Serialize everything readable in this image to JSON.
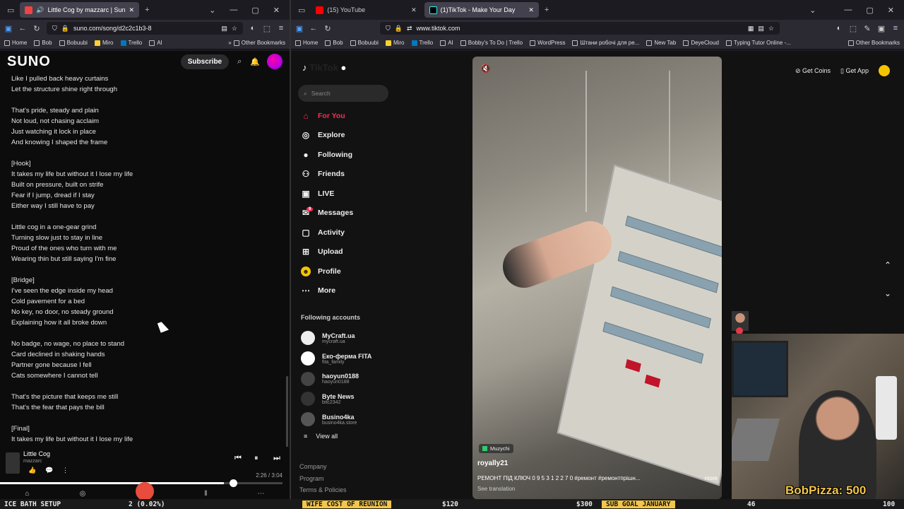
{
  "left_browser": {
    "tabs": [
      {
        "label": "Little Cog by mazzarc | Sun",
        "active": true
      }
    ],
    "url": "suno.com/song/d2c2c1b3-8",
    "bookmarks": [
      "Home",
      "Bob",
      "Bobuubi",
      "Miro",
      "Trello",
      "AI"
    ],
    "other_bookmarks": "Other Bookmarks"
  },
  "suno": {
    "logo": "SUNO",
    "subscribe": "Subscribe",
    "lyrics": [
      "Like I pulled back heavy curtains",
      "Let the structure shine right through",
      "",
      "That's pride, steady and plain",
      "Not loud, not chasing acclaim",
      "Just watching it lock in place",
      "And knowing I shaped the frame",
      "",
      "[Hook]",
      "It takes my life but without it I lose my life",
      "Built on pressure, built on strife",
      "Fear if I jump, dread if I stay",
      "Either way I still have to pay",
      "",
      "Little cog in a one-gear grind",
      "Turning slow just to stay in line",
      "Proud of the ones who turn with me",
      "Wearing thin but still saying I'm fine",
      "",
      "[Bridge]",
      "I've seen the edge inside my head",
      "Cold pavement for a bed",
      "No key, no door, no steady ground",
      "Explaining how it all broke down",
      "",
      "No badge, no wage, no place to stand",
      "Card declined in shaking hands",
      "Partner gone because I fell",
      "Cats somewhere I cannot tell",
      "",
      "That's the picture that keeps me still",
      "That's the fear that pays the bill",
      "",
      "[Final]",
      "It takes my life but without it I lose my life"
    ],
    "player": {
      "title": "Little Cog",
      "artist": "mazzarc",
      "time": "2:26 / 3:04",
      "progress": 0.793
    }
  },
  "right_browser": {
    "tabs": [
      {
        "label": "(15) YouTube",
        "active": false
      },
      {
        "label": "(1)TikTok - Make Your Day",
        "active": true
      }
    ],
    "url": "www.tiktok.com",
    "bookmarks": [
      "Home",
      "Bob",
      "Bobuubi",
      "Miro",
      "Trello",
      "AI",
      "Bobby's To Do | Trello",
      "WordPress",
      "Штани робочі для ре...",
      "New Tab",
      "DeyeCloud",
      "Typing Tutor Online -..."
    ],
    "other_bookmarks": "Other Bookmarks"
  },
  "tiktok": {
    "search_placeholder": "Search",
    "nav": [
      {
        "label": "For You",
        "icon": "home-icon",
        "active": true
      },
      {
        "label": "Explore",
        "icon": "compass-icon",
        "active": false
      },
      {
        "label": "Following",
        "icon": "following-icon",
        "active": false
      },
      {
        "label": "Friends",
        "icon": "friends-icon",
        "active": false
      },
      {
        "label": "LIVE",
        "icon": "live-icon",
        "active": false
      },
      {
        "label": "Messages",
        "icon": "messages-icon",
        "active": false,
        "badge": "9"
      },
      {
        "label": "Activity",
        "icon": "activity-icon",
        "active": false
      },
      {
        "label": "Upload",
        "icon": "upload-icon",
        "active": false
      },
      {
        "label": "Profile",
        "icon": "profile-icon",
        "active": false
      },
      {
        "label": "More",
        "icon": "more-icon",
        "active": false
      }
    ],
    "following_title": "Following accounts",
    "following": [
      {
        "name": "MyCraft.ua",
        "handle": "mycraft.ua"
      },
      {
        "name": "Еко-ферма FITA",
        "handle": "fita_family"
      },
      {
        "name": "haoyun0188",
        "handle": "haoyun0188"
      },
      {
        "name": "Byte News",
        "handle": "bitc2342"
      },
      {
        "name": "Businо4ka",
        "handle": "businо4ka.store"
      }
    ],
    "view_all": "View all",
    "footer": [
      "Company",
      "Program",
      "Terms & Policies"
    ],
    "get_coins": "Get Coins",
    "get_app": "Get App",
    "video": {
      "tag": "Muzychi",
      "author": "royally21",
      "description": "РЕМОНТ ПІД КЛЮЧ 0 9 5 3 1 2 2 7 0 #ремонт #ремонтпрішн...",
      "more": "more",
      "translation": "See translation"
    }
  },
  "stream": {
    "overlay": "BobPizza: 500",
    "ticker": [
      "ICE BATH SETUP",
      "2 (0.02%)",
      "WIFE COST OF REUNION",
      "$120",
      "$300",
      "SUB GOAL JANUARY",
      "46",
      "100"
    ]
  }
}
